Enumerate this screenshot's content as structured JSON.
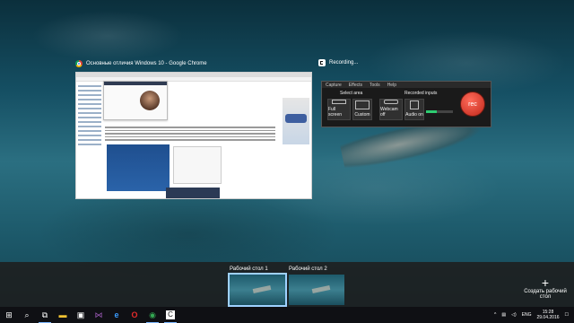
{
  "chrome_window": {
    "title": "Основные отличия Windows 10 - Google Chrome"
  },
  "recording_window": {
    "title": "Recording...",
    "menu": [
      "Capture",
      "Effects",
      "Tools",
      "Help"
    ],
    "select_area_label": "Select area",
    "recorded_inputs_label": "Recorded inputs",
    "full_screen": "Full screen",
    "custom": "Custom",
    "webcam": "Webcam off",
    "audio": "Audio on",
    "rec_button": "rec",
    "audio_level": 0.4
  },
  "desktops": [
    {
      "label": "Рабочий стол 1",
      "active": true
    },
    {
      "label": "Рабочий стол 2",
      "active": false
    }
  ],
  "new_desktop": {
    "icon": "+",
    "label": "Создать рабочий стол"
  },
  "taskbar": {
    "start": "⊞",
    "search": "⌕",
    "task_view": "⧉",
    "apps": [
      {
        "name": "file-explorer-icon",
        "glyph": "▬",
        "color": "#f1c232"
      },
      {
        "name": "store-icon",
        "glyph": "▣",
        "color": "#ffffff"
      },
      {
        "name": "visual-studio-icon",
        "glyph": "⋈",
        "color": "#9b59b6"
      },
      {
        "name": "edge-icon",
        "glyph": "e",
        "color": "#3b9cff"
      },
      {
        "name": "opera-icon",
        "glyph": "O",
        "color": "#e32b2b"
      },
      {
        "name": "chrome-icon",
        "glyph": "◉",
        "color": "#34a853"
      },
      {
        "name": "capture-app-icon",
        "glyph": "C",
        "color": "#ffffff"
      }
    ]
  },
  "tray": {
    "chevron": "^",
    "network": "▤",
    "volume": "◁)",
    "language": "ENG",
    "time": "15:28",
    "date": "29.04.2016",
    "notifications": "☐"
  }
}
